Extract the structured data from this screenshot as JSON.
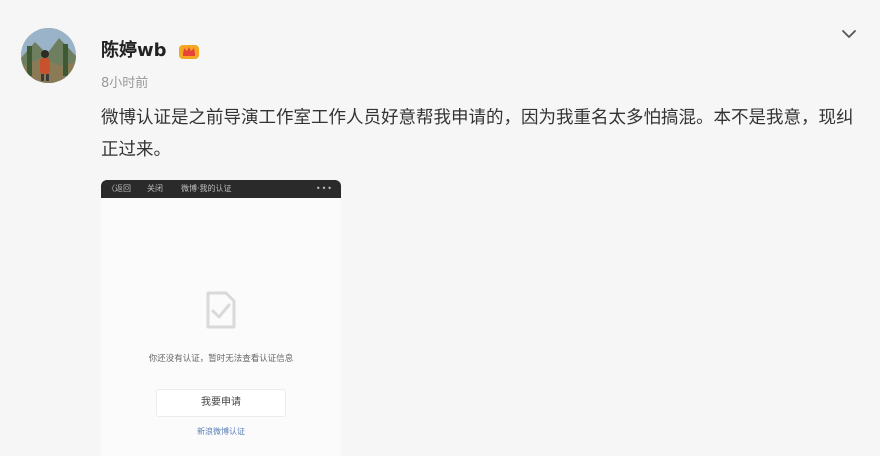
{
  "author": {
    "name": "陈婷wb",
    "avatar_icon": "avatar-photo-icon",
    "badge_icon": "vip-crown-icon",
    "badge_color": "#f5a623"
  },
  "post": {
    "timestamp": "8小时前",
    "text": "微博认证是之前导演工作室工作人员好意帮我申请的，因为我重名太多怕搞混。本不是我意，现纠正过来。",
    "more_icon": "chevron-down-icon"
  },
  "embedded_screenshot": {
    "back_label": "〈返回",
    "close_label": "关闭",
    "title": "微博·我的认证",
    "dots": "•••",
    "icon": "document-check-icon",
    "message": "你还没有认证，暂时无法查看认证信息",
    "button_label": "我要申请",
    "link_label": "新浪微博认证"
  }
}
